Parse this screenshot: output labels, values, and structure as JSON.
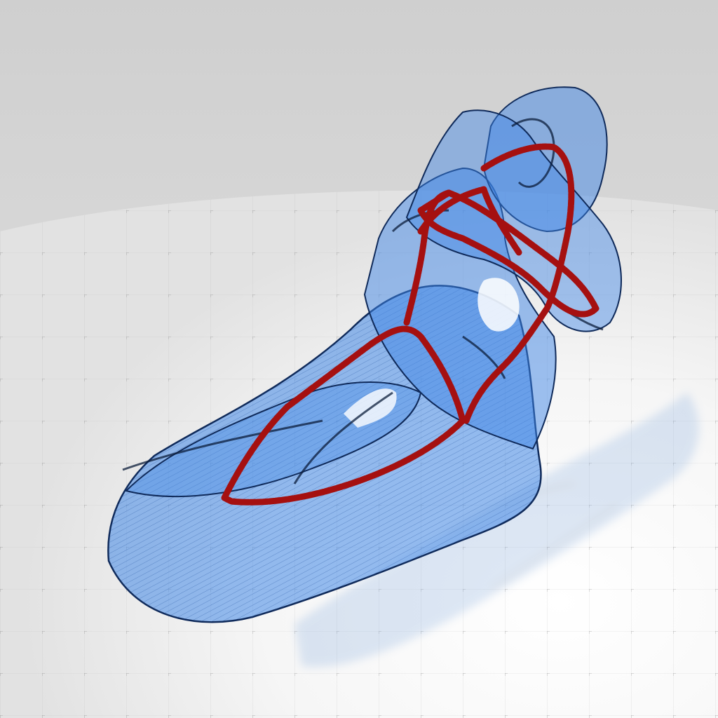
{
  "scene": {
    "kind": "voxelized 3D figure render",
    "volume_color": "#3f86e6",
    "volume_edge_color": "#0f2a5a",
    "skeleton_color": "#a51010",
    "floor_color": "#f4f4f4",
    "backdrop_color": "#d8d8d8",
    "grid_color": "#9a9a9a"
  }
}
